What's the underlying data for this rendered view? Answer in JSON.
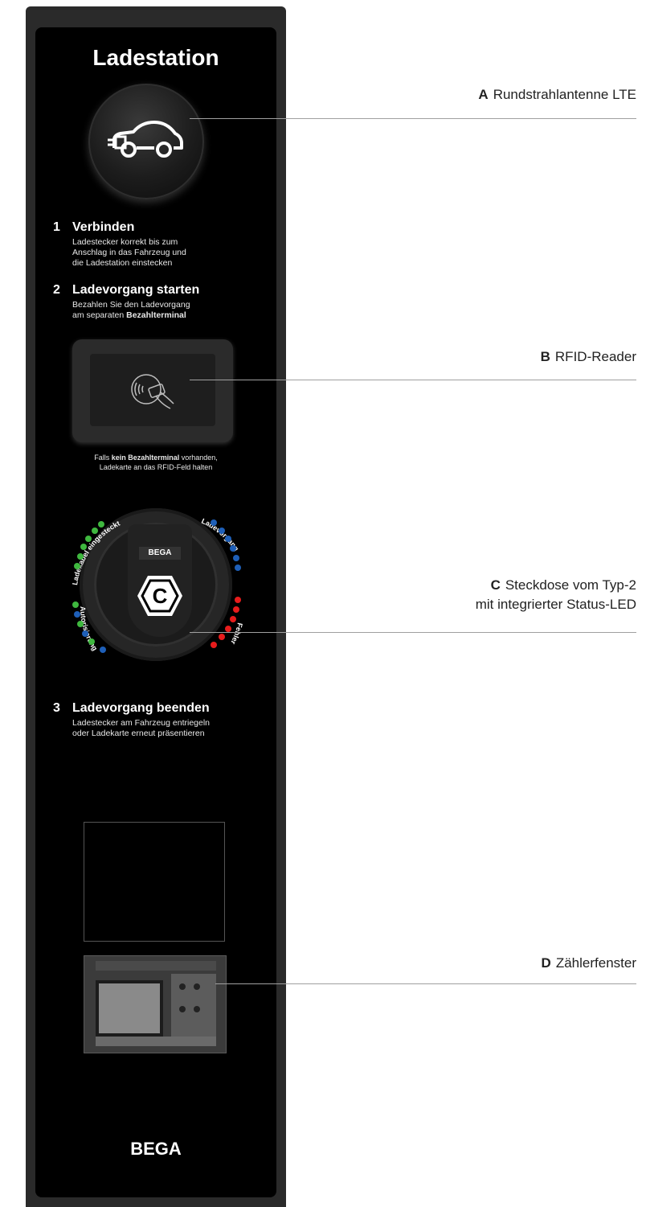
{
  "station": {
    "title": "Ladestation",
    "brand": "BEGA",
    "steps": [
      {
        "num": "1",
        "heading": "Verbinden",
        "lines": [
          "Ladestecker korrekt bis zum",
          "Anschlag in das Fahrzeug und",
          "die Ladestation einstecken"
        ]
      },
      {
        "num": "2",
        "heading": "Ladevorgang starten",
        "line1": "Bezahlen Sie den Ladevorgang",
        "line2_prefix": "am separaten ",
        "line2_bold": "Bezahlterminal"
      },
      {
        "num": "3",
        "heading": "Ladevorgang beenden",
        "lines": [
          "Ladestecker am Fahrzeug entriegeln",
          "oder Ladekarte erneut präsentieren"
        ]
      }
    ],
    "rfid_note": {
      "prefix": "Falls ",
      "bold": "kein Bezahlterminal",
      "suffix": " vorhanden,",
      "line2": "Ladekarte an das RFID-Feld halten"
    },
    "socket": {
      "brand_tag": "BEGA",
      "badge": "C",
      "led_labels": {
        "left_top": "Ladekabel eingesteckt",
        "left_bottom": "Autorisierung",
        "right_top": "Ladevorgang",
        "right_bottom": "Fehler"
      }
    },
    "icons": {
      "lte": "electric-car-icon",
      "rfid": "contactless-card-icon"
    }
  },
  "callouts": [
    {
      "letter": "A",
      "label": "Rundstrahlantenne LTE"
    },
    {
      "letter": "B",
      "label": "RFID-Reader"
    },
    {
      "letter": "C",
      "label": "Steckdose vom Typ-2",
      "line2": "mit integrierter Status-LED"
    },
    {
      "letter": "D",
      "label": "Zählerfenster"
    }
  ],
  "colors": {
    "led_green": "#3fb83f",
    "led_blue": "#1e5fb8",
    "led_red": "#e81c1c",
    "panel": "#000000",
    "housing": "#2a2a2a"
  }
}
